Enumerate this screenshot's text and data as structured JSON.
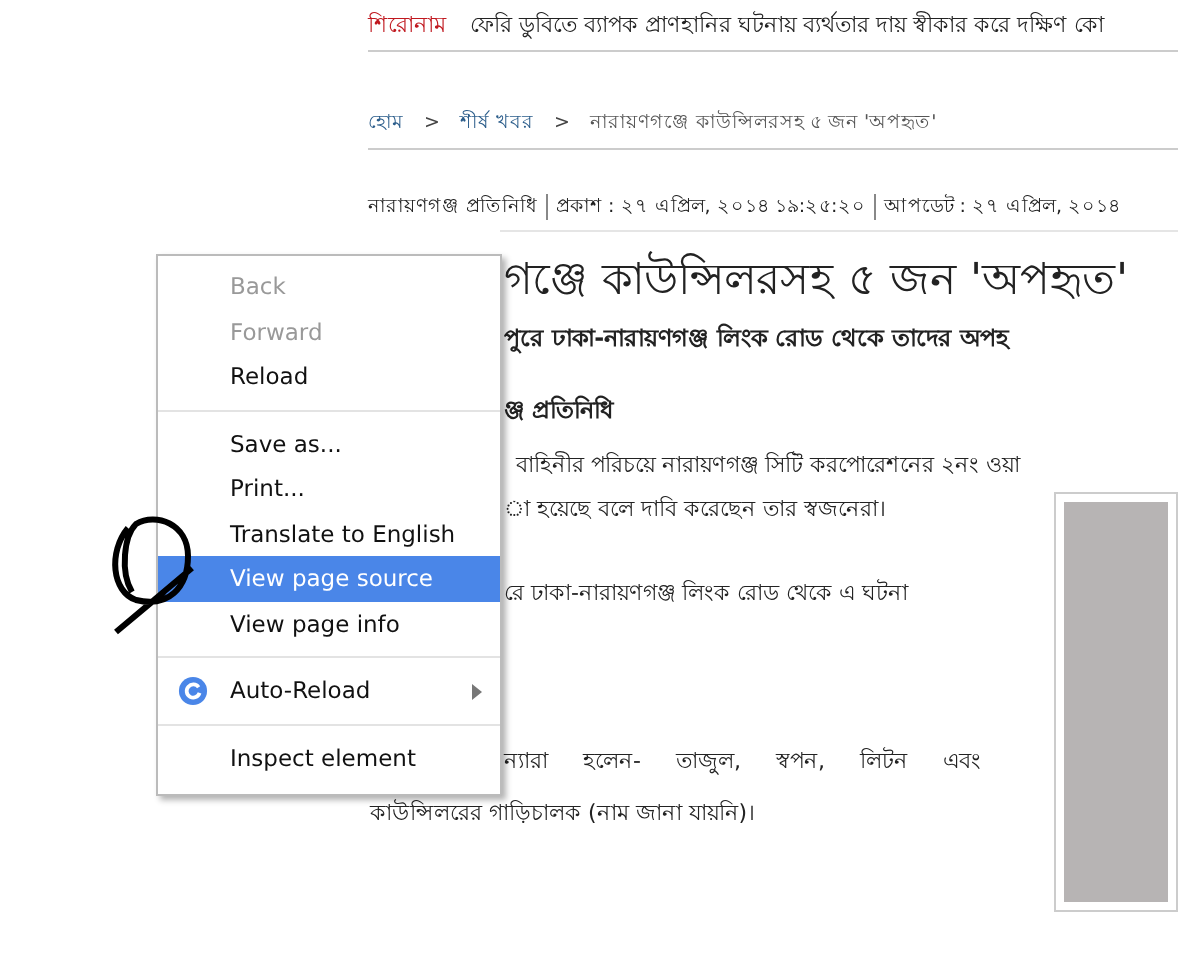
{
  "ticker": {
    "label": "শিরোনাম",
    "text": "ফেরি ডুবিতে ব্যাপক প্রাণহানির ঘটনায় ব্যর্থতার দায় স্বীকার করে দক্ষিণ কো"
  },
  "breadcrumb": [
    "হোম",
    "শীর্ষ খবর",
    "নারায়ণগঞ্জে কাউন্সিলরসহ ৫ জন 'অপহৃত'"
  ],
  "breadcrumb_separator": ">",
  "byline": {
    "author": "নারায়ণগঞ্জ প্রতিনিধি",
    "published": "প্রকাশ : ২৭ এপ্রিল, ২০১৪ ১৯:২৫:২০",
    "updated": "আপডেট : ২৭ এপ্রিল, ২০১৪"
  },
  "article": {
    "headline": "গঞ্জে কাউন্সিলরসহ ৫ জন 'অপহৃত'",
    "summary": "পুরে ঢাকা-নারায়ণগঞ্জ লিংক রোড থেকে তাদের অপহ",
    "reporter": "ঞ্জ প্রতিনিধি",
    "paragraphs": [
      {
        "lines": [
          "বাহিনীর পরিচয়ে নারায়ণগঞ্জ সিটি করপোরেশনের ২নং ওয়া",
          "া হয়েছে বলে দাবি করেছেন তার স্বজনেরা।"
        ]
      },
      {
        "lines": [
          "রে ঢাকা-নারায়ণগঞ্জ লিংক রোড থেকে এ ঘটনা"
        ]
      },
      {
        "lines": [
          "ন্যারা হলেন- তাজুল, স্বপন, লিটন এবং",
          "কাউন্সিলরের গাড়িচালক (নাম জানা যায়নি)।"
        ]
      }
    ]
  },
  "context_menu": {
    "groups": [
      [
        {
          "kind": "plain",
          "label": "Back",
          "disabled": true,
          "selected": false
        },
        {
          "kind": "plain",
          "label": "Forward",
          "disabled": true,
          "selected": false
        },
        {
          "kind": "plain",
          "label": "Reload",
          "disabled": false,
          "selected": false
        }
      ],
      [
        {
          "kind": "plain",
          "label": "Save as...",
          "disabled": false,
          "selected": false
        },
        {
          "kind": "plain",
          "label": "Print...",
          "disabled": false,
          "selected": false
        },
        {
          "kind": "plain",
          "label": "Translate to English",
          "disabled": false,
          "selected": false
        },
        {
          "kind": "plain",
          "label": "View page source",
          "disabled": false,
          "selected": true
        },
        {
          "kind": "plain",
          "label": "View page info",
          "disabled": false,
          "selected": false
        }
      ],
      [
        {
          "kind": "extension",
          "label": "Auto-Reload",
          "disabled": false,
          "selected": false,
          "submenu": true
        }
      ],
      [
        {
          "kind": "plain",
          "label": "Inspect element",
          "disabled": false,
          "selected": false
        }
      ]
    ]
  }
}
